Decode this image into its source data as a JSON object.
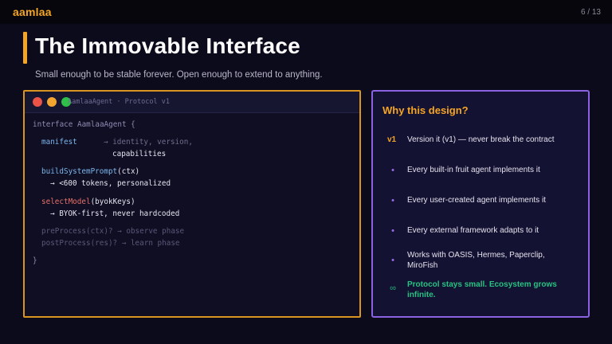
{
  "brand": "aamlaa",
  "pager": "6 / 13",
  "title": "The Immovable Interface",
  "subtitle": "Small enough to be stable forever. Open enough to extend to anything.",
  "code": {
    "tab": "AamlaaAgent  ·  Protocol v1",
    "open": "interface AamlaaAgent {",
    "manifest": "manifest",
    "manifest_note1": "→ identity, version,",
    "manifest_note2": "capabilities",
    "build_fn": "buildSystemPrompt",
    "build_args": "(ctx)",
    "build_note": "→ <600 tokens, personalized",
    "select_fn": "selectModel",
    "select_args": "(byokKeys)",
    "select_note": "→ BYOK-first, never hardcoded",
    "pre_line": "preProcess(ctx)?  → observe phase",
    "post_line": "postProcess(res)?  → learn phase",
    "close": "}"
  },
  "why": {
    "title": "Why this design?",
    "items": [
      {
        "marker": "v1",
        "text": "Version it (v1) — never break the contract"
      },
      {
        "marker": "•",
        "text": "Every built-in fruit agent implements it"
      },
      {
        "marker": "•",
        "text": "Every user-created agent implements it"
      },
      {
        "marker": "•",
        "text": "Every external framework adapts to it"
      },
      {
        "marker": "•",
        "text": "Works with OASIS, Hermes, Paperclip, MiroFish"
      },
      {
        "marker": "∞",
        "text": "Protocol stays small. Ecosystem grows infinite."
      }
    ]
  },
  "colors": {
    "accent": "#f5a524",
    "purple": "#8b62e0",
    "green": "#27c282",
    "background": "#0c0b1c"
  }
}
